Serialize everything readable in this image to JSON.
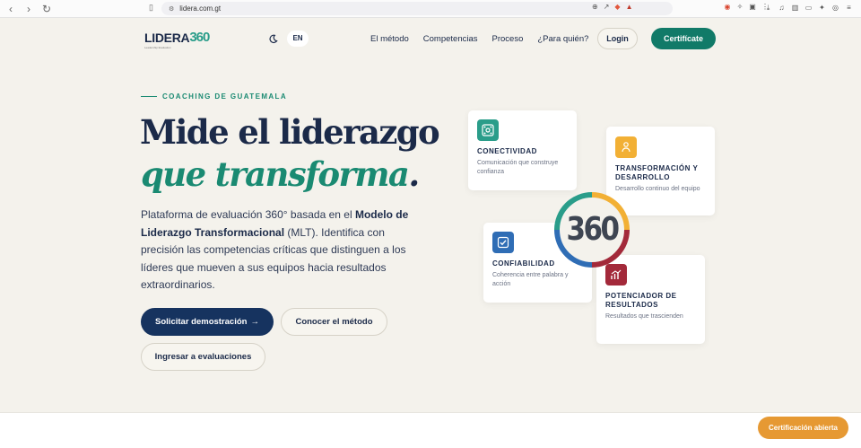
{
  "browser": {
    "url": "lidera.com.gt"
  },
  "header": {
    "logo_text": "LIDERA",
    "logo_number": "360",
    "logo_tagline": "Leadership Evaluation",
    "lang": "EN",
    "nav": [
      "El método",
      "Competencias",
      "Proceso",
      "¿Para quién?"
    ],
    "login": "Login",
    "certify": "Certifícate"
  },
  "hero": {
    "eyebrow": "COACHING DE GUATEMALA",
    "title_line1": "Mide el liderazgo",
    "title_line2": "que transforma",
    "title_dot": ".",
    "desc_part1": "Plataforma de evaluación 360° basada en el ",
    "desc_bold": "Modelo de Liderazgo Transformacional",
    "desc_part2": " (MLT). Identifica con precisión las competencias críticas que distinguen a los líderes que mueven a sus equipos hacia resultados extraordinarios.",
    "btn_demo": "Solicitar demostración",
    "btn_demo_arrow": "→",
    "btn_method": "Conocer el método",
    "btn_eval": "Ingresar a evaluaciones"
  },
  "cards": [
    {
      "title": "CONECTIVIDAD",
      "subtitle": "Comunicación que construye confianza",
      "icon": "network-icon",
      "color": "#2a9d8a"
    },
    {
      "title": "TRANSFORMACIÓN Y DESARROLLO",
      "subtitle": "Desarrollo continuo del equipo",
      "icon": "growth-icon",
      "color": "#f2b035"
    },
    {
      "title": "CONFIABILIDAD",
      "subtitle": "Coherencia entre palabra y acción",
      "icon": "check-shield-icon",
      "color": "#2f6db5"
    },
    {
      "title": "POTENCIADOR DE RESULTADOS",
      "subtitle": "Resultados que trascienden",
      "icon": "chart-icon",
      "color": "#a3293a"
    }
  ],
  "center_ring": {
    "number": "360"
  },
  "floating_badge": "Certificación abierta",
  "colors": {
    "navy": "#16335f",
    "teal": "#117a68",
    "orange": "#e69933",
    "background": "#f4f2ec"
  }
}
